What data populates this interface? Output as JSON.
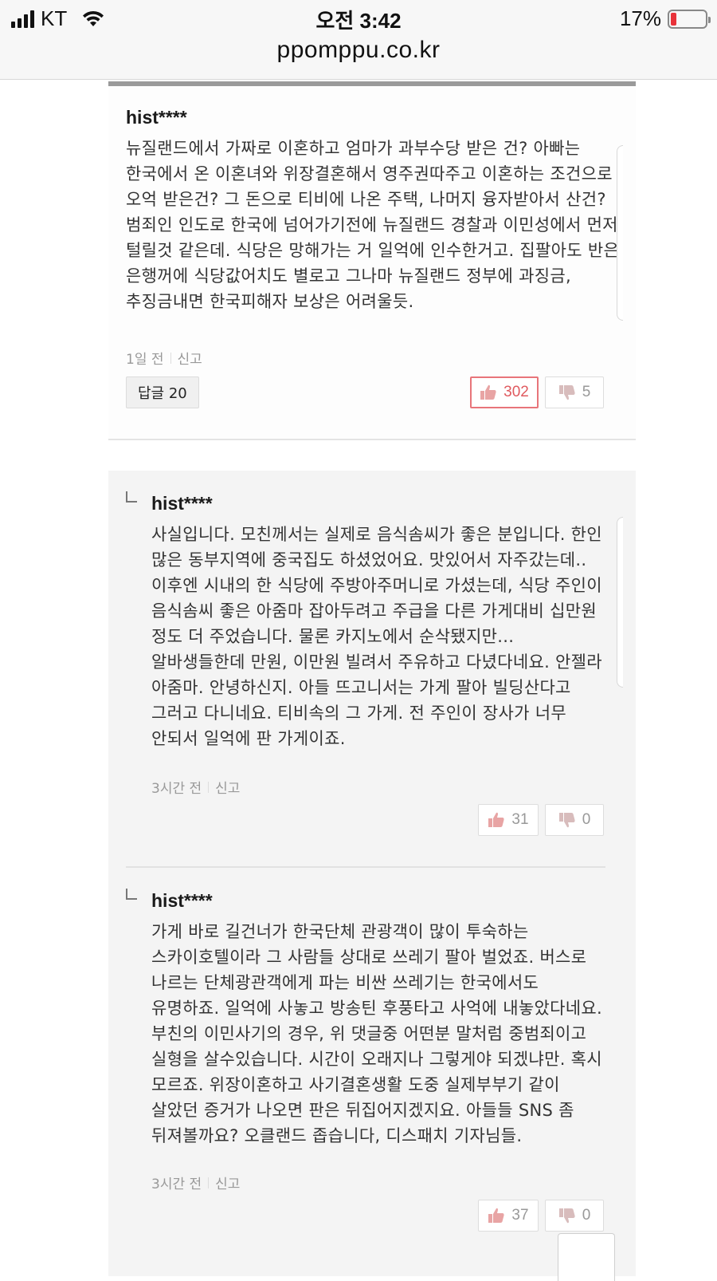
{
  "status_bar": {
    "carrier": "KT",
    "time": "오전 3:42",
    "battery_percent": "17%",
    "battery_level": 0.17,
    "battery_color": "#e8323a"
  },
  "browser": {
    "url": "ppomppu.co.kr"
  },
  "comments": [
    {
      "author": "hist****",
      "text": "뉴질랜드에서 가짜로 이혼하고 엄마가 과부수당 받은 건? 아빠는 한국에서 온 이혼녀와 위장결혼해서 영주권따주고 이혼하는 조건으로 오억 받은건? 그 돈으로 티비에 나온 주택, 나머지 융자받아서 산건? 범죄인 인도로 한국에 넘어가기전에 뉴질랜드 경찰과 이민성에서 먼저 털릴것 같은데. 식당은 망해가는 거 일억에 인수한거고. 집팔아도 반은 은행꺼에 식당값어치도 별로고 그나마 뉴질랜드 정부에 과징금, 추징금내면 한국피해자 보상은 어려울듯.",
      "time": "1일 전",
      "report": "신고",
      "reply_button": "답글 20",
      "likes": "302",
      "dislikes": "5"
    }
  ],
  "replies": [
    {
      "author": "hist****",
      "text": "사실입니다. 모친께서는 실제로 음식솜씨가 좋은 분입니다. 한인 많은 동부지역에 중국집도 하셨었어요. 맛있어서 자주갔는데.. 이후엔 시내의 한 식당에 주방아주머니로 가셨는데, 식당 주인이 음식솜씨 좋은 아줌마 잡아두려고 주급을 다른 가게대비 십만원 정도 더 주었습니다. 물론 카지노에서 순삭됐지만... 알바생들한데 만원, 이만원 빌려서 주유하고 다녔다네요. 안젤라 아줌마. 안녕하신지. 아들 뜨고니서는 가게 팔아 빌딩산다고 그러고 다니네요. 티비속의 그 가게. 전 주인이 장사가 너무 안되서 일억에 판 가게이죠.",
      "time": "3시간 전",
      "report": "신고",
      "likes": "31",
      "dislikes": "0"
    },
    {
      "author": "hist****",
      "text": "가게 바로 길건너가 한국단체 관광객이 많이 투숙하는 스카이호텔이라 그 사람들 상대로 쓰레기 팔아 벌었죠. 버스로 나르는 단체광관객에게 파는 비싼 쓰레기는 한국에서도 유명하죠. 일억에 사놓고 방송틴 후풍타고 사억에 내놓았다네요. 부친의 이민사기의 경우, 위 댓글중 어떤분 말처럼 중범죄이고 실형을 살수있습니다. 시간이 오래지나 그렇게야 되겠냐만. 혹시 모르죠. 위장이혼하고 사기결혼생활 도중 실제부부기 같이 살았던 증거가 나오면 판은 뒤집어지겠지요. 아들들 SNS 좀 뒤져볼까요? 오클랜드 좁습니다, 디스패치 기자님들.",
      "time": "3시간 전",
      "report": "신고",
      "likes": "37",
      "dislikes": "0"
    }
  ]
}
